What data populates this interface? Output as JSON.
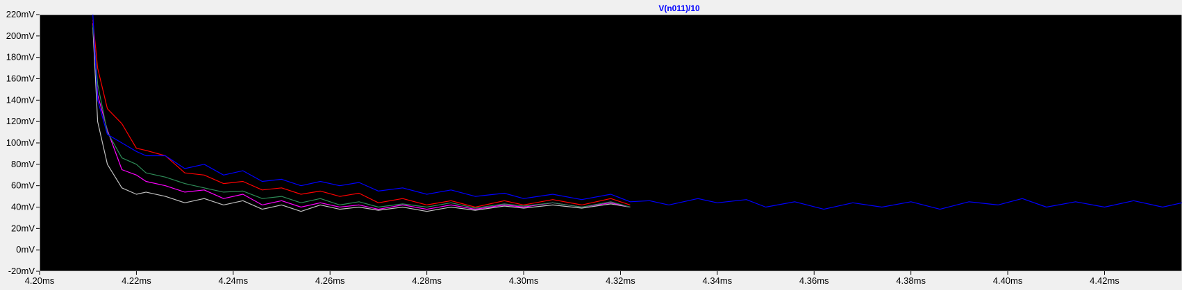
{
  "chart_data": {
    "type": "line",
    "title": "V(n011)/10",
    "title_color": "#0000ff",
    "background": "#000000",
    "axis_color": "#ffffff",
    "xlim": [
      4.2,
      4.436
    ],
    "ylim": [
      -20,
      220
    ],
    "x_unit": "ms",
    "y_unit": "mV",
    "x_ticks": [
      "4.20ms",
      "4.22ms",
      "4.24ms",
      "4.26ms",
      "4.28ms",
      "4.30ms",
      "4.32ms",
      "4.34ms",
      "4.36ms",
      "4.38ms",
      "4.40ms",
      "4.42ms"
    ],
    "x_tick_values": [
      4.2,
      4.22,
      4.24,
      4.26,
      4.28,
      4.3,
      4.32,
      4.34,
      4.36,
      4.38,
      4.4,
      4.42
    ],
    "y_ticks": [
      "220mV",
      "200mV",
      "180mV",
      "160mV",
      "140mV",
      "120mV",
      "100mV",
      "80mV",
      "60mV",
      "40mV",
      "20mV",
      "0mV",
      "-20mV"
    ],
    "y_tick_values": [
      220,
      200,
      180,
      160,
      140,
      120,
      100,
      80,
      60,
      40,
      20,
      0,
      -20
    ],
    "grid": false,
    "series": [
      {
        "color": "#0000ff",
        "points": [
          [
            4.211,
            220
          ],
          [
            4.212,
            140
          ],
          [
            4.214,
            108
          ],
          [
            4.217,
            100
          ],
          [
            4.22,
            92
          ],
          [
            4.222,
            88
          ],
          [
            4.226,
            88
          ],
          [
            4.23,
            76
          ],
          [
            4.234,
            80
          ],
          [
            4.238,
            70
          ],
          [
            4.242,
            74
          ],
          [
            4.246,
            64
          ],
          [
            4.25,
            66
          ],
          [
            4.254,
            60
          ],
          [
            4.258,
            64
          ],
          [
            4.262,
            60
          ],
          [
            4.266,
            63
          ],
          [
            4.27,
            55
          ],
          [
            4.275,
            58
          ],
          [
            4.28,
            52
          ],
          [
            4.285,
            56
          ],
          [
            4.29,
            50
          ],
          [
            4.296,
            53
          ],
          [
            4.3,
            48
          ],
          [
            4.306,
            52
          ],
          [
            4.312,
            47
          ],
          [
            4.318,
            52
          ],
          [
            4.322,
            45
          ],
          [
            4.326,
            46
          ],
          [
            4.33,
            42
          ],
          [
            4.336,
            48
          ],
          [
            4.34,
            44
          ],
          [
            4.346,
            47
          ],
          [
            4.35,
            40
          ],
          [
            4.356,
            45
          ],
          [
            4.362,
            38
          ],
          [
            4.368,
            44
          ],
          [
            4.374,
            40
          ],
          [
            4.38,
            45
          ],
          [
            4.386,
            38
          ],
          [
            4.392,
            45
          ],
          [
            4.398,
            42
          ],
          [
            4.403,
            48
          ],
          [
            4.408,
            40
          ],
          [
            4.414,
            45
          ],
          [
            4.42,
            40
          ],
          [
            4.426,
            46
          ],
          [
            4.432,
            40
          ],
          [
            4.436,
            44
          ]
        ]
      },
      {
        "color": "#ff0000",
        "points": [
          [
            4.211,
            215
          ],
          [
            4.212,
            170
          ],
          [
            4.214,
            132
          ],
          [
            4.217,
            118
          ],
          [
            4.22,
            95
          ],
          [
            4.222,
            93
          ],
          [
            4.226,
            88
          ],
          [
            4.23,
            72
          ],
          [
            4.234,
            70
          ],
          [
            4.238,
            62
          ],
          [
            4.242,
            64
          ],
          [
            4.246,
            56
          ],
          [
            4.25,
            58
          ],
          [
            4.254,
            52
          ],
          [
            4.258,
            55
          ],
          [
            4.262,
            50
          ],
          [
            4.266,
            53
          ],
          [
            4.27,
            44
          ],
          [
            4.275,
            48
          ],
          [
            4.28,
            42
          ],
          [
            4.285,
            46
          ],
          [
            4.29,
            40
          ],
          [
            4.296,
            46
          ],
          [
            4.3,
            42
          ],
          [
            4.306,
            47
          ],
          [
            4.312,
            42
          ],
          [
            4.318,
            48
          ],
          [
            4.322,
            42
          ]
        ]
      },
      {
        "color": "#2e8b57",
        "points": [
          [
            4.211,
            210
          ],
          [
            4.212,
            155
          ],
          [
            4.214,
            110
          ],
          [
            4.217,
            86
          ],
          [
            4.22,
            80
          ],
          [
            4.222,
            72
          ],
          [
            4.226,
            68
          ],
          [
            4.23,
            62
          ],
          [
            4.234,
            58
          ],
          [
            4.238,
            54
          ],
          [
            4.242,
            55
          ],
          [
            4.246,
            48
          ],
          [
            4.25,
            50
          ],
          [
            4.254,
            44
          ],
          [
            4.258,
            48
          ],
          [
            4.262,
            42
          ],
          [
            4.266,
            45
          ],
          [
            4.27,
            40
          ],
          [
            4.275,
            43
          ],
          [
            4.28,
            40
          ],
          [
            4.285,
            44
          ],
          [
            4.29,
            39
          ],
          [
            4.296,
            43
          ],
          [
            4.3,
            41
          ],
          [
            4.306,
            44
          ],
          [
            4.312,
            40
          ],
          [
            4.318,
            45
          ],
          [
            4.322,
            40
          ]
        ]
      },
      {
        "color": "#ff00ff",
        "points": [
          [
            4.211,
            212
          ],
          [
            4.212,
            145
          ],
          [
            4.214,
            112
          ],
          [
            4.217,
            75
          ],
          [
            4.22,
            70
          ],
          [
            4.222,
            64
          ],
          [
            4.226,
            60
          ],
          [
            4.23,
            54
          ],
          [
            4.234,
            56
          ],
          [
            4.238,
            48
          ],
          [
            4.242,
            52
          ],
          [
            4.246,
            42
          ],
          [
            4.25,
            46
          ],
          [
            4.254,
            40
          ],
          [
            4.258,
            44
          ],
          [
            4.262,
            40
          ],
          [
            4.266,
            42
          ],
          [
            4.27,
            38
          ],
          [
            4.275,
            42
          ],
          [
            4.28,
            38
          ],
          [
            4.285,
            42
          ],
          [
            4.29,
            38
          ],
          [
            4.296,
            42
          ],
          [
            4.3,
            40
          ],
          [
            4.306,
            44
          ],
          [
            4.312,
            40
          ],
          [
            4.318,
            44
          ],
          [
            4.322,
            40
          ]
        ]
      },
      {
        "color": "#c0c0c0",
        "points": [
          [
            4.211,
            208
          ],
          [
            4.212,
            120
          ],
          [
            4.214,
            80
          ],
          [
            4.217,
            58
          ],
          [
            4.22,
            52
          ],
          [
            4.222,
            54
          ],
          [
            4.226,
            50
          ],
          [
            4.23,
            44
          ],
          [
            4.234,
            48
          ],
          [
            4.238,
            42
          ],
          [
            4.242,
            46
          ],
          [
            4.246,
            38
          ],
          [
            4.25,
            42
          ],
          [
            4.254,
            36
          ],
          [
            4.258,
            42
          ],
          [
            4.262,
            38
          ],
          [
            4.266,
            40
          ],
          [
            4.27,
            37
          ],
          [
            4.275,
            40
          ],
          [
            4.28,
            36
          ],
          [
            4.285,
            40
          ],
          [
            4.29,
            37
          ],
          [
            4.296,
            41
          ],
          [
            4.3,
            39
          ],
          [
            4.306,
            42
          ],
          [
            4.312,
            39
          ],
          [
            4.318,
            43
          ],
          [
            4.322,
            40
          ]
        ]
      }
    ]
  }
}
